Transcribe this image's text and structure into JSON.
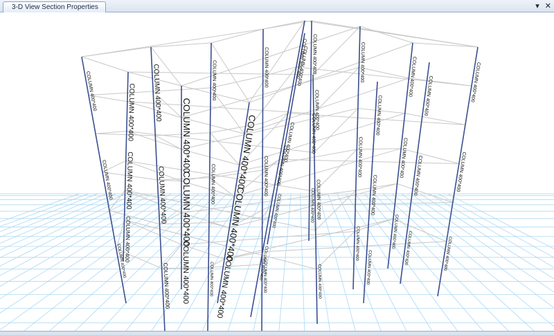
{
  "window": {
    "tab_title": "3-D View  Section Properties",
    "dropdown_glyph": "▾",
    "close_glyph": "✕",
    "icons": {
      "dropdown": "chevron-down-icon",
      "close": "close-icon"
    }
  },
  "model": {
    "column_section_label": "COLUMN 400*400",
    "colors": {
      "column": "#3b4f8f",
      "beam": "#c8c8c8",
      "ground_grid": "#9fd3f2",
      "background": "#ffffff"
    }
  }
}
